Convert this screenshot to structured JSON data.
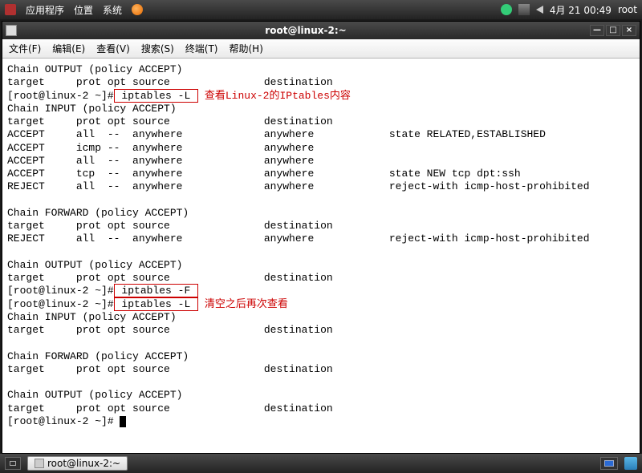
{
  "top_panel": {
    "apps": "应用程序",
    "places": "位置",
    "system": "系统",
    "clock": "4月 21  00:49",
    "user": "root"
  },
  "window": {
    "title": "root@linux-2:~",
    "min": "—",
    "max": "□",
    "close": "×"
  },
  "menubar": {
    "file": "文件(F)",
    "edit": "编辑(E)",
    "view": "查看(V)",
    "search": "搜索(S)",
    "terminal": "终端(T)",
    "help": "帮助(H)"
  },
  "annotations": {
    "a1": "查看Linux-2的IPtables内容",
    "a2": "清空之后再次查看"
  },
  "term": {
    "l01": "Chain OUTPUT (policy ACCEPT)",
    "l02": "target     prot opt source               destination",
    "p1": "[root@linux-2 ~]#",
    "cmd1": " iptables -L ",
    "l04": "Chain INPUT (policy ACCEPT)",
    "l05": "target     prot opt source               destination",
    "l06": "ACCEPT     all  --  anywhere             anywhere            state RELATED,ESTABLISHED",
    "l07": "ACCEPT     icmp --  anywhere             anywhere",
    "l08": "ACCEPT     all  --  anywhere             anywhere",
    "l09": "ACCEPT     tcp  --  anywhere             anywhere            state NEW tcp dpt:ssh",
    "l10": "REJECT     all  --  anywhere             anywhere            reject-with icmp-host-prohibited",
    "l11": "Chain FORWARD (policy ACCEPT)",
    "l12": "target     prot opt source               destination",
    "l13": "REJECT     all  --  anywhere             anywhere            reject-with icmp-host-prohibited",
    "l14": "Chain OUTPUT (policy ACCEPT)",
    "l15": "target     prot opt source               destination",
    "p2": "[root@linux-2 ~]#",
    "cmd2": " iptables -F ",
    "p3": "[root@linux-2 ~]#",
    "cmd3": " iptables -L ",
    "l18": "Chain INPUT (policy ACCEPT)",
    "l19": "target     prot opt source               destination",
    "l20": "Chain FORWARD (policy ACCEPT)",
    "l21": "target     prot opt source               destination",
    "l22": "Chain OUTPUT (policy ACCEPT)",
    "l23": "target     prot opt source               destination",
    "p4": "[root@linux-2 ~]# "
  },
  "taskbar": {
    "task1": "root@linux-2:~"
  }
}
